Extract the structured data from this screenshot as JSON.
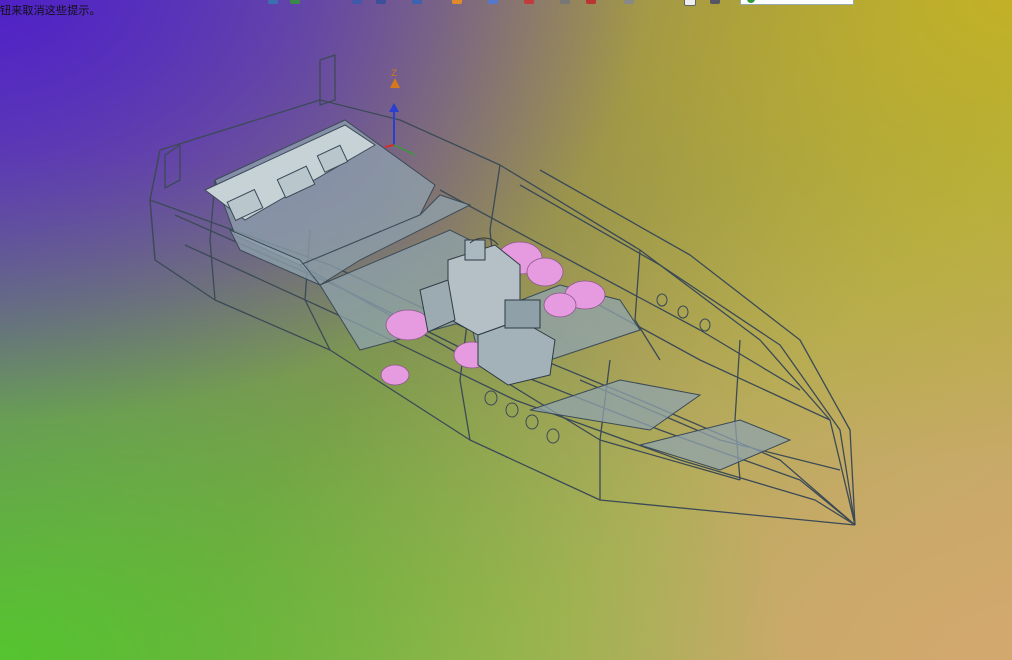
{
  "hint": "钮来取消这些提示。",
  "view_selector": {
    "value": ""
  },
  "colors": {
    "frame_stroke": "#3b4a56",
    "deck_fill": "#8fa3ad",
    "float_fill": "#e69ae0",
    "triad_x": "#d0302a",
    "triad_y": "#3a9a3a",
    "triad_z": "#2a3fd0",
    "triad_label": "#d4781c"
  },
  "triad": {
    "label": "Z"
  },
  "icons": [
    "toolbar-icon",
    "view-orientation-icon",
    "coordinate-triad-icon"
  ]
}
